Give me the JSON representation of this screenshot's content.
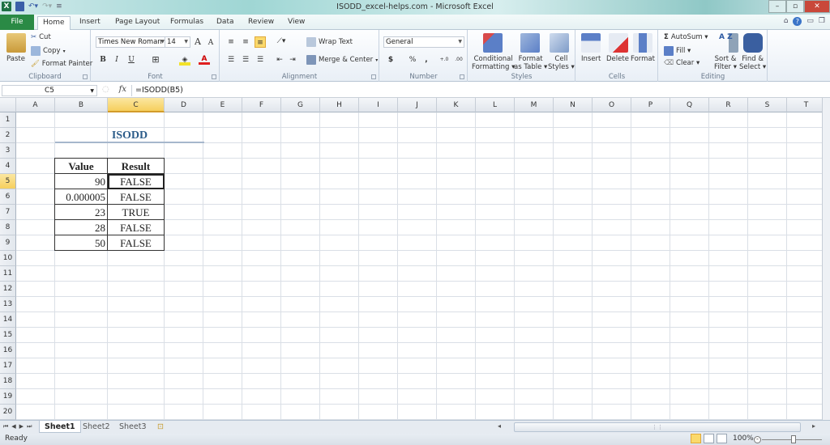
{
  "window": {
    "title": "ISODD_excel-helps.com  -  Microsoft Excel",
    "app_icon": "X",
    "controls": {
      "minimize": "–",
      "maximize": "▫",
      "close": "✕"
    }
  },
  "ribbon_tabs": [
    "File",
    "Home",
    "Insert",
    "Page Layout",
    "Formulas",
    "Data",
    "Review",
    "View"
  ],
  "active_tab": "Home",
  "clipboard": {
    "paste": "Paste",
    "cut": "Cut",
    "copy": "Copy",
    "format_painter": "Format Painter",
    "label": "Clipboard"
  },
  "font": {
    "name": "Times New Roman",
    "size": "14",
    "bold": "B",
    "italic": "I",
    "underline": "U",
    "grow": "A",
    "shrink": "A",
    "label": "Font"
  },
  "alignment": {
    "wrap_text": "Wrap Text",
    "merge_center": "Merge & Center",
    "label": "Alignment"
  },
  "number": {
    "format": "General",
    "currency": "$",
    "percent": "%",
    "comma": ",",
    "inc_decimal": "+.0",
    "dec_decimal": ".00",
    "label": "Number"
  },
  "styles": {
    "conditional": [
      "Conditional",
      "Formatting ▾"
    ],
    "format_table": [
      "Format",
      "as Table ▾"
    ],
    "cell_styles": [
      "Cell",
      "Styles ▾"
    ],
    "label": "Styles"
  },
  "cells": {
    "insert": "Insert",
    "delete": "Delete",
    "format": "Format",
    "label": "Cells"
  },
  "editing": {
    "autosum": "AutoSum ▾",
    "fill": "Fill ▾",
    "clear": "Clear ▾",
    "sort_filter": [
      "Sort &",
      "Filter ▾"
    ],
    "find_select": [
      "Find &",
      "Select ▾"
    ],
    "label": "Editing"
  },
  "formula_bar": {
    "name_box": "C5",
    "fx": "fx",
    "formula": "=ISODD(B5)"
  },
  "columns": [
    "A",
    "B",
    "C",
    "D",
    "E",
    "F",
    "G",
    "H",
    "I",
    "J",
    "K",
    "L",
    "M",
    "N",
    "O",
    "P",
    "Q",
    "R",
    "S",
    "T"
  ],
  "selected_column": "C",
  "rows": [
    "1",
    "2",
    "3",
    "4",
    "5",
    "6",
    "7",
    "8",
    "9",
    "10",
    "11",
    "12",
    "13",
    "14",
    "15",
    "16",
    "17",
    "18",
    "19",
    "20"
  ],
  "selected_row": "5",
  "sheet": {
    "title": "ISODD",
    "headers": [
      "Value",
      "Result"
    ],
    "table": [
      {
        "value": "90",
        "result": "FALSE"
      },
      {
        "value": "0.000005",
        "result": "FALSE"
      },
      {
        "value": "23",
        "result": "TRUE"
      },
      {
        "value": "28",
        "result": "FALSE"
      },
      {
        "value": "50",
        "result": "FALSE"
      }
    ]
  },
  "sheet_tabs": [
    "Sheet1",
    "Sheet2",
    "Sheet3"
  ],
  "active_sheet": "Sheet1",
  "status": {
    "mode": "Ready",
    "zoom": "100%"
  }
}
